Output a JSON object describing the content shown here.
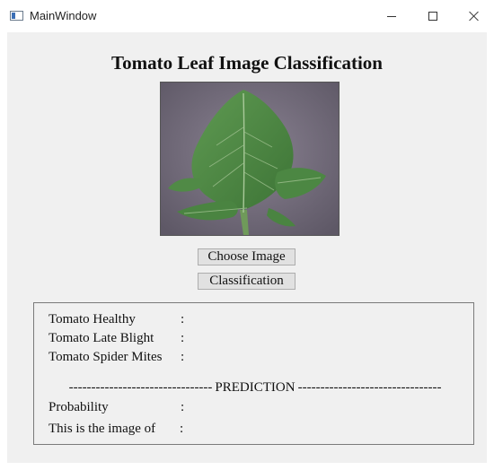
{
  "window": {
    "title": "MainWindow"
  },
  "heading": "Tomato Leaf Image Classification",
  "image": {
    "icon": "tomato-leaf-image"
  },
  "buttons": {
    "choose_image": "Choose Image",
    "classification": "Classification"
  },
  "results": {
    "rows": [
      {
        "label": "Tomato Healthy",
        "separator": ":"
      },
      {
        "label": "Tomato Late Blight",
        "separator": ":"
      },
      {
        "label": "Tomato Spider Mites",
        "separator": ":"
      }
    ],
    "divider": {
      "dashes": "--------------------------------",
      "label": "PREDICTION"
    },
    "probability": {
      "label": "Probability",
      "separator": ":"
    },
    "image_of": {
      "label": "This is the image of",
      "separator": ":"
    }
  }
}
